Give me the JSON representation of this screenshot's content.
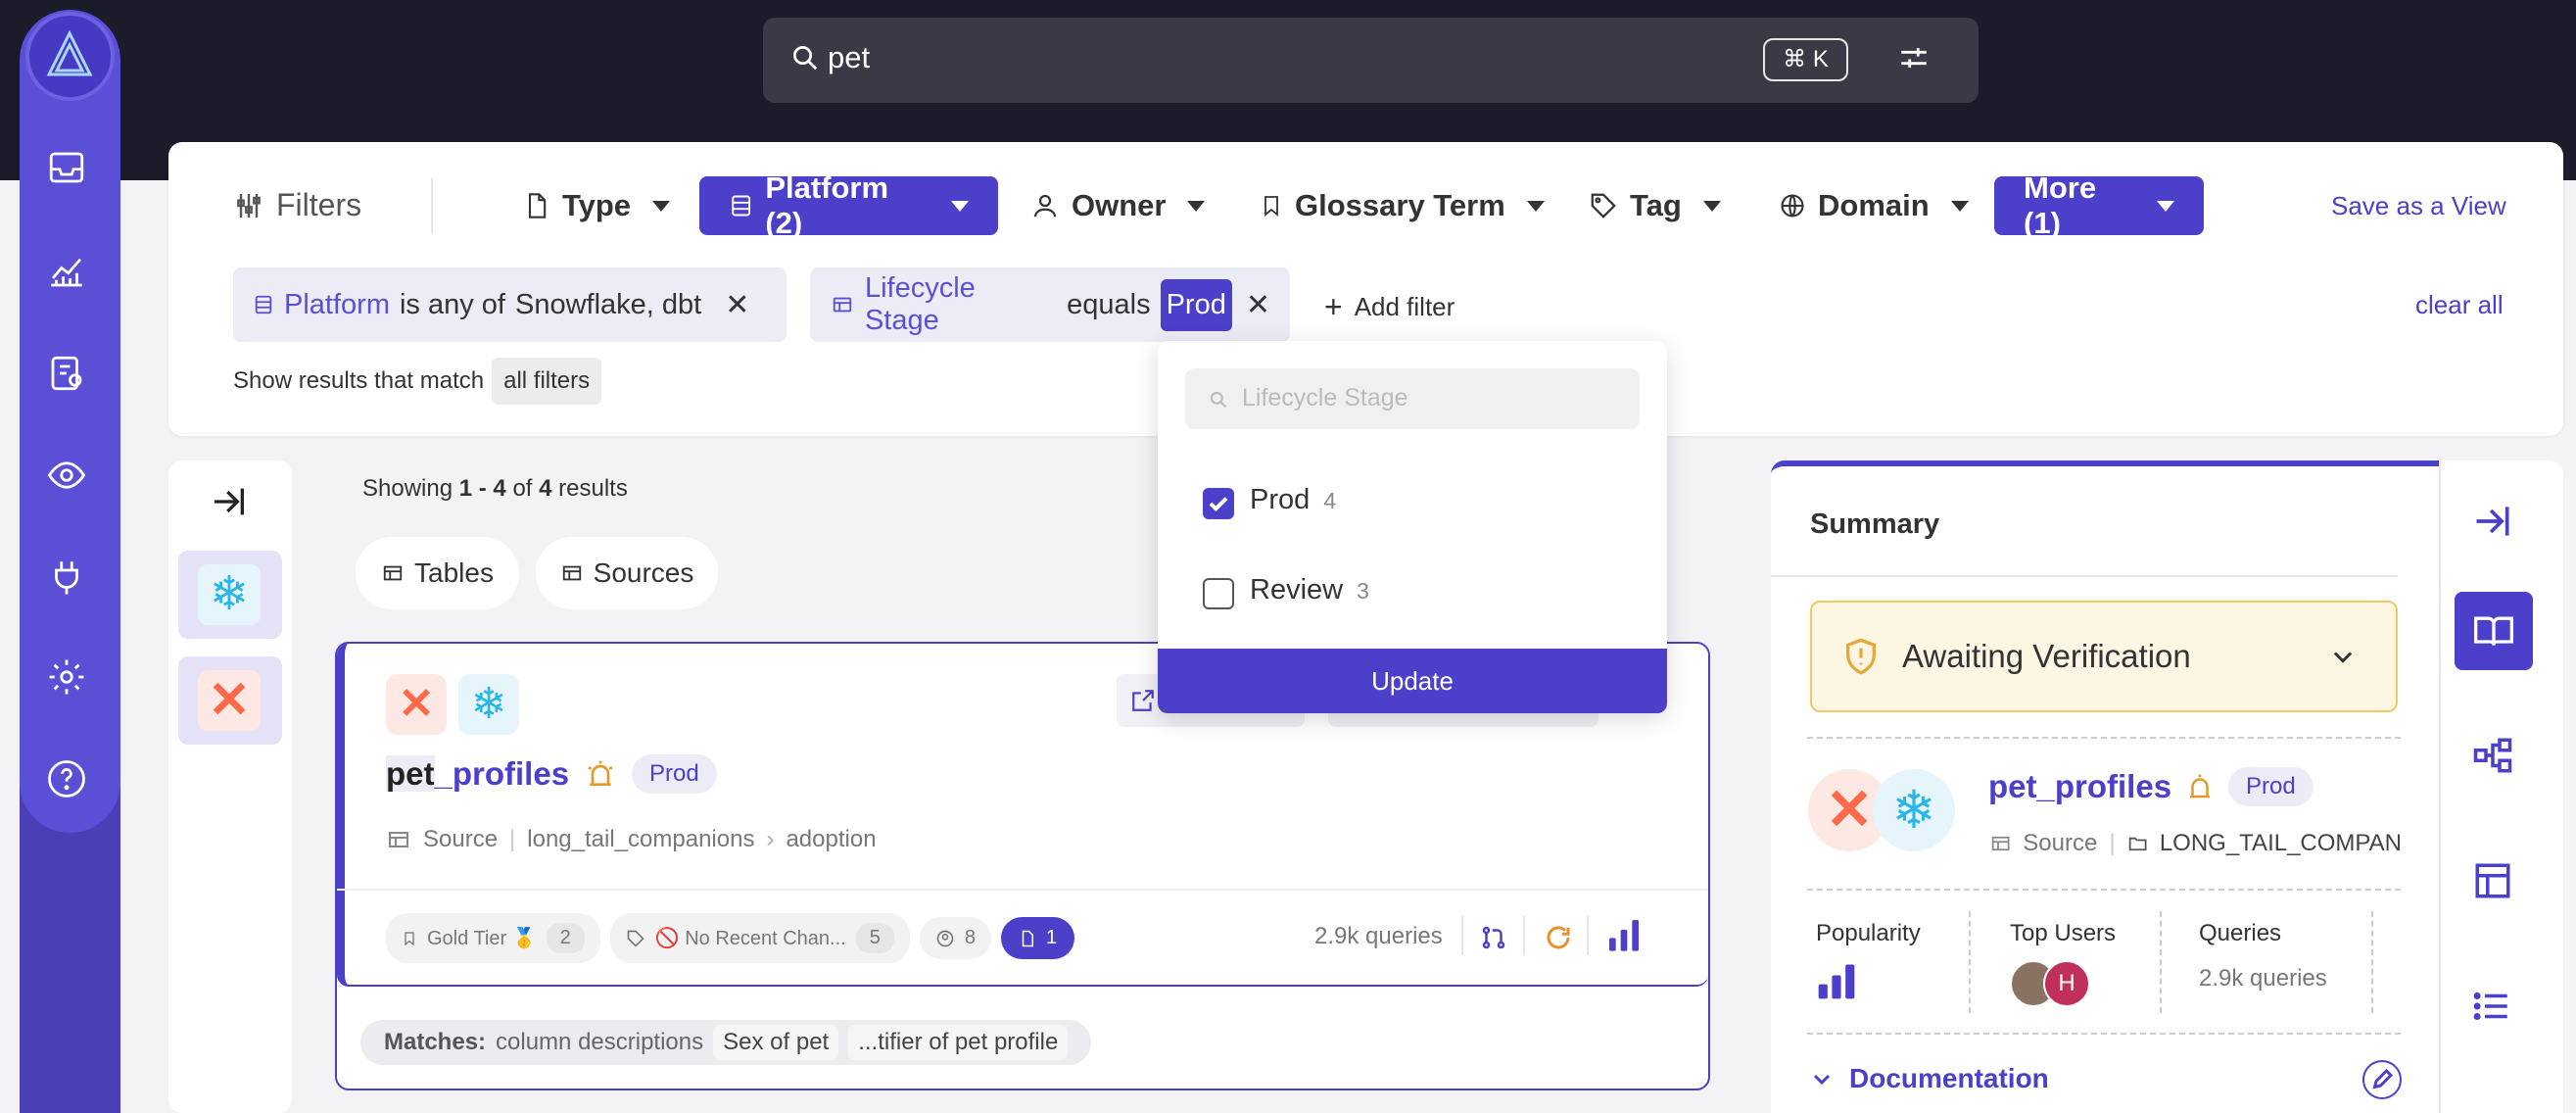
{
  "search": {
    "query": "pet",
    "shortcut": "⌘ K"
  },
  "filters": {
    "title": "Filters",
    "type": "Type",
    "platform": "Platform (2)",
    "owner": "Owner",
    "glossary": "Glossary Term",
    "tag": "Tag",
    "domain": "Domain",
    "more": "More (1)",
    "save_view": "Save as a View",
    "clear_all": "clear all",
    "add_filter": "Add filter",
    "match_prefix": "Show results that match",
    "match_mode": "all filters"
  },
  "active_filters": {
    "platform": {
      "key": "Platform",
      "op": "is any of",
      "value": "Snowflake, dbt"
    },
    "lifecycle": {
      "key": "Lifecycle Stage",
      "op": "equals",
      "value": "Prod"
    }
  },
  "dropdown": {
    "placeholder": "Lifecycle Stage",
    "options": [
      {
        "label": "Prod",
        "count": "4",
        "checked": true
      },
      {
        "label": "Review",
        "count": "3",
        "checked": false
      }
    ],
    "update": "Update"
  },
  "results": {
    "showing_prefix": "Showing",
    "showing_range": "1 - 4",
    "of": "of",
    "total": "4",
    "suffix": "results",
    "tabs": [
      "Tables",
      "Sources"
    ]
  },
  "result": {
    "name_highlight": "pet",
    "name_rest": "_profiles",
    "stage": "Prod",
    "type": "Source",
    "path": "long_tail_companions",
    "subpath": "adoption",
    "gold_tier": "Gold Tier 🥇",
    "gold_count": "2",
    "no_recent": "🚫 No Recent Chan...",
    "no_recent_count": "5",
    "owners_count": "8",
    "docs_count": "1",
    "queries": "2.9k queries",
    "matches_label": "Matches:",
    "matches_field": "column descriptions",
    "matches_1": "Sex of pet",
    "matches_2": "...tifier of pet profile"
  },
  "summary": {
    "title": "Summary",
    "verification": "Awaiting Verification",
    "name": "pet_profiles",
    "stage": "Prod",
    "type": "Source",
    "path": "LONG_TAIL_COMPAN",
    "popularity_label": "Popularity",
    "top_users_label": "Top Users",
    "avatar_letter": "H",
    "queries_label": "Queries",
    "queries_value": "2.9k queries",
    "documentation": "Documentation"
  },
  "colors": {
    "accent": "#4c3fc9",
    "sidebar": "#5b4fd6",
    "topbar": "#1b1b2a",
    "dbt": "#ff6849",
    "snowflake": "#29b5e8"
  }
}
